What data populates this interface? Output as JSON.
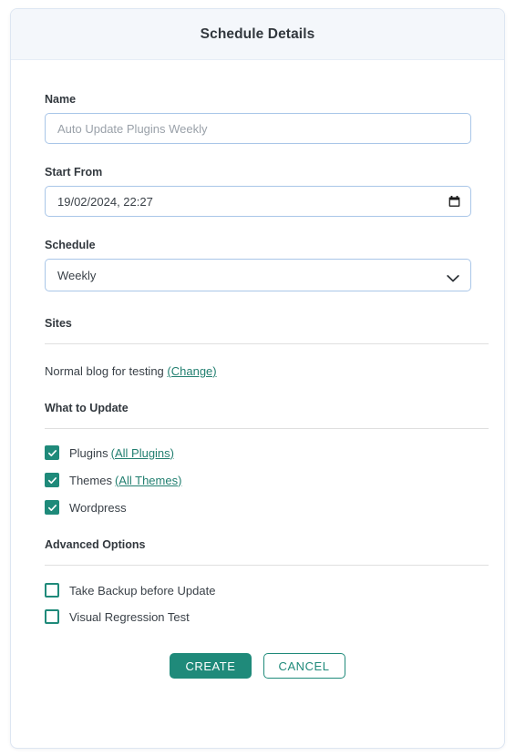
{
  "dialog": {
    "title": "Schedule Details"
  },
  "form": {
    "name": {
      "label": "Name",
      "value": "",
      "placeholder": "Auto Update Plugins Weekly"
    },
    "start_from": {
      "label": "Start From",
      "value": "19/02/2024, 22:27",
      "icon": "calendar-icon"
    },
    "schedule": {
      "label": "Schedule",
      "value": "Weekly",
      "icon": "chevron-down-icon",
      "options": [
        "Weekly"
      ]
    }
  },
  "sites": {
    "heading": "Sites",
    "site_name": "Normal blog for testing",
    "change_link": "(Change)"
  },
  "what_to_update": {
    "heading": "What to Update",
    "items": [
      {
        "label": "Plugins",
        "link": "(All Plugins)",
        "checked": true
      },
      {
        "label": "Themes",
        "link": "(All Themes)",
        "checked": true
      },
      {
        "label": "Wordpress",
        "link": "",
        "checked": true
      }
    ]
  },
  "advanced_options": {
    "heading": "Advanced Options",
    "items": [
      {
        "label": "Take Backup before Update",
        "checked": false
      },
      {
        "label": "Visual Regression Test",
        "checked": false
      }
    ]
  },
  "actions": {
    "create_label": "CREATE",
    "cancel_label": "CANCEL"
  },
  "colors": {
    "accent": "#1f8a7a",
    "link": "#227f70",
    "header_bg": "#f4f7fb",
    "input_border": "#a9c6e8",
    "text": "#3a4148",
    "heading": "#32383e",
    "divider": "#dfdfdf"
  }
}
